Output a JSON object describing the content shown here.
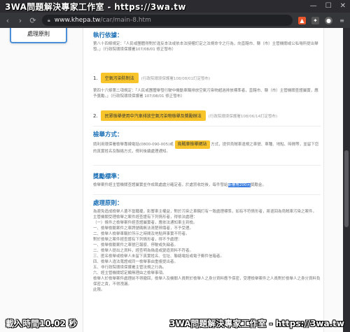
{
  "window": {
    "title": "3WA問題解決專家工作室 - https://3wa.tw",
    "controls": [
      "—",
      "☐",
      "✕"
    ]
  },
  "browser": {
    "url_host": "www.khepa.tw",
    "url_path": "/car/main-8.htm",
    "back": "‹",
    "forward": "›",
    "reload": "⟳"
  },
  "sidebar": {
    "card_label": "處理原則"
  },
  "content": {
    "exec_basis": {
      "heading": "執行依據：",
      "text": "第八十四條規定：「人民或團體得對於違反本法或依本法授權訂定之法規命令之行為，向直轄市、縣（市）主管機關或公私場所提出舉發。」（行政院環境保護署107/08/01 修正發布）"
    },
    "item1": {
      "num": "1.",
      "btn": "空氣污染防制法",
      "note": "(行政院環境保護署108/08/01訂定發布)"
    },
    "item1_text": "第四十六條第二項規定：「人民或團體舉發行駛中機動車輛排放空氣污染物超過排放標準者，直轄市、縣（市）主管機關查證屬實，應予獎勵。」（行政院環境保護署 107/08/01 修正發布）",
    "item2": {
      "num": "2.",
      "btn": "民眾檢舉使用中汽車排放空氣污染物檢舉及獎勵辦法",
      "note": "(行政院環境保護署108/06/14訂定發布)"
    },
    "method": {
      "heading": "檢舉方式：",
      "text_pre": "請利用環保署檢舉專線電話(0800-090-005)或",
      "btn": "烏賊車檢舉網站",
      "text_post": "方式，提供烏賊車違規之車號、車種、地點、時間等，並留下您的真實姓名及聯絡方式，俾利後續處理通知。"
    },
    "reward": {
      "heading": "獎勵標準：",
      "text_pre": "檢舉案件經主管機關查證屬實並作成裁處處分確定者，於處罰收訖後，每件發給",
      "highlight": "新臺幣200元",
      "text_post": "獎勵金。"
    },
    "principle": {
      "heading": "處理原則：",
      "lines": [
        "為避免造成檢舉人遭不當騷擾，影響車主權益，對於污染之車輛訂有一致處理標準，如有不符情形者，將退回為烏賊車污染之案件，",
        "主管機關受理檢舉之案件經查證有下列情形者，得依法處理：",
        "（一）條件之檢舉案件經查證屬實者，應依法通知車主到檢。",
        "一、檢舉檢驗案件之車牌號碼無法清楚辨識者，不予受理。",
        "二、檢舉人檢舉車輛於所示之時間及地點與事實不符者。",
        "對於檢舉之案件經查證有下列情形者，得不予處理：",
        "一、檢舉檢驗案件之車號已報廢、停駛或失竊者。",
        "二、檢舉人提出之資料，經查明為偽造或變造資料不符者。",
        "三、匿名檢舉或檢舉人未留下真實姓名、住址、聯絡電話或電子郵件信箱者。",
        "四、檢舉人違法蒐證或同一檢舉事由重複提出者。",
        "五、非行政院環境保護署主管法規之行為。",
        "六、經主管機關認定顯無理由之檢舉事項。",
        "檢舉人於檢舉案件處理前不得撤回，檢舉人及機關人員對於檢舉人之身分資料應予保密，受理檢舉案件之人員對於檢舉人之身分資料負保密之責，不得洩漏。",
        "此限。"
      ]
    }
  },
  "overlays": {
    "left": "載入時間10.02 秒",
    "right": "3WA問題解決專家工作室 - https://3wa.tw"
  }
}
